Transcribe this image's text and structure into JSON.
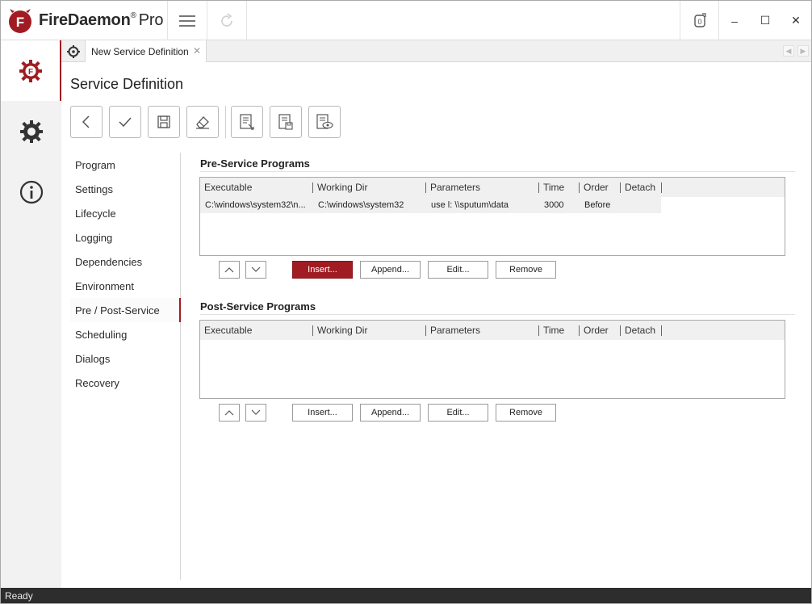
{
  "app": {
    "name": "FireDaemon",
    "registered": "®",
    "edition": "Pro",
    "accent_color": "#a01c22"
  },
  "titlebar": {
    "menu_icon": "hamburger-icon",
    "refresh_icon": "refresh-icon",
    "pin_icon": "pin-icon",
    "minimize": "–",
    "maximize": "☐",
    "close": "✕"
  },
  "rail": {
    "items": [
      {
        "name": "services",
        "icon": "firedaemon-gear-icon",
        "active": true
      },
      {
        "name": "settings",
        "icon": "gear-icon",
        "active": false
      },
      {
        "name": "about",
        "icon": "info-icon",
        "active": false
      }
    ]
  },
  "tabs": [
    {
      "label": "New Service Definition",
      "close": "✕"
    }
  ],
  "page": {
    "title": "Service Definition"
  },
  "toolbar": {
    "buttons": [
      {
        "name": "back",
        "icon": "chevron-left-icon"
      },
      {
        "name": "apply",
        "icon": "check-icon"
      },
      {
        "name": "save",
        "icon": "floppy-icon"
      },
      {
        "name": "clear",
        "icon": "eraser-icon"
      },
      {
        "name": "import",
        "icon": "document-import-icon"
      },
      {
        "name": "export",
        "icon": "document-save-icon"
      },
      {
        "name": "preview",
        "icon": "document-preview-icon"
      }
    ]
  },
  "subnav": {
    "items": [
      "Program",
      "Settings",
      "Lifecycle",
      "Logging",
      "Dependencies",
      "Environment",
      "Pre / Post-Service",
      "Scheduling",
      "Dialogs",
      "Recovery"
    ],
    "active": "Pre / Post-Service"
  },
  "pre_service": {
    "title": "Pre-Service Programs",
    "columns": [
      "Executable",
      "Working Dir",
      "Parameters",
      "Time",
      "Order",
      "Detach"
    ],
    "rows": [
      {
        "executable": "C:\\windows\\system32\\n...",
        "working_dir": "C:\\windows\\system32",
        "parameters": "use l: \\\\sputum\\data",
        "time": "3000",
        "order": "Before",
        "detach": ""
      }
    ],
    "buttons": {
      "insert": "Insert...",
      "append": "Append...",
      "edit": "Edit...",
      "remove": "Remove"
    }
  },
  "post_service": {
    "title": "Post-Service Programs",
    "columns": [
      "Executable",
      "Working Dir",
      "Parameters",
      "Time",
      "Order",
      "Detach"
    ],
    "rows": [],
    "buttons": {
      "insert": "Insert...",
      "append": "Append...",
      "edit": "Edit...",
      "remove": "Remove"
    }
  },
  "status": {
    "text": "Ready"
  }
}
